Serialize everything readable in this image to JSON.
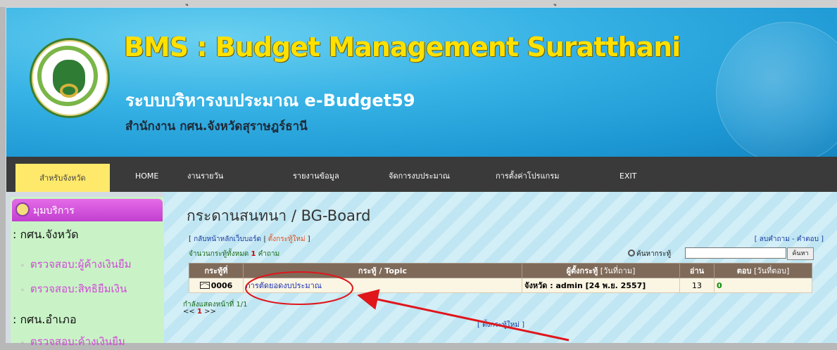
{
  "top_strip": {
    "left_text": "ู",
    "right_text": "ู"
  },
  "banner": {
    "title": "BMS : Budget Management Suratthani",
    "subtitle": "ระบบบริหารงบประมาณ e-Budget59",
    "office": "สำนักงาน กศน.จังหวัดสุราษฎร์ธานี",
    "seal_icon": "ministry-seal-logo"
  },
  "nav": {
    "active": "สำหรับจังหวัด",
    "items": [
      "HOME",
      "งานรายวัน",
      "รายงานข้อมูล",
      "จัดการงบประมาณ",
      "การตั้งค่าโปรแกรม",
      "EXIT"
    ]
  },
  "sidebar": {
    "header": "มุมบริการ",
    "section1": ": กศน.จังหวัด",
    "links1": [
      "ตรวจสอบ:ผู้ค้างเงินยืม",
      "ตรวจสอบ:สิทธิยืมเงิน"
    ],
    "section2": ": กศน.อำเภอ",
    "links2": [
      "ตรวจสอบ:ค้างเงินยืม"
    ]
  },
  "board": {
    "page_title": "กระดานสนทนา / BG-Board",
    "top_left_open": "[ ",
    "link_home": "กลับหน้าหลักเว็บบอร์ด",
    "sep": " | ",
    "link_new": "ตั้งกระทู้ใหม่",
    "top_left_close": " ]",
    "top_right": "[ ลบคำถาม - คำตอบ ]",
    "count_prefix": "จำนวนกระทู้ทั้งหมด ",
    "count_value": "1",
    "count_suffix": " คำถาม",
    "search_label": "ค้นหากระทู้",
    "search_value": "",
    "search_button": "ค้นหา",
    "columns": {
      "id": "กระทู้ที่",
      "topic": "กระทู้ / Topic",
      "author": "ผู้ตั้งกระทู้",
      "author_sub": " [วันที่ถาม]",
      "reads": "อ่าน",
      "replies": "ตอบ",
      "replies_sub": " [วันที่ตอบ]"
    },
    "rows": [
      {
        "id": "0006",
        "topic": "การตัดยอดงบประมาณ",
        "author": "จังหวัด : admin [24 พ.ย. 2557]",
        "reads": "13",
        "replies": "0"
      }
    ],
    "page_info": "กำลังแสดงหน้าที่ 1/1",
    "pager_prev": "<< ",
    "pager_current": "1",
    "pager_next": " >>",
    "new_topic_bottom": "[ ตั้งกระทู้ใหม่ ]"
  },
  "colors": {
    "banner_blue": "#36b2e5",
    "title_yellow": "#ffe100",
    "nav_bg": "#3a3a3a",
    "nav_active": "#ffe96a",
    "sidebar_bg": "#c9f3c6",
    "sidebar_header": "#d155de",
    "table_header": "#7f6a59",
    "annotation_red": "#e0161b"
  }
}
